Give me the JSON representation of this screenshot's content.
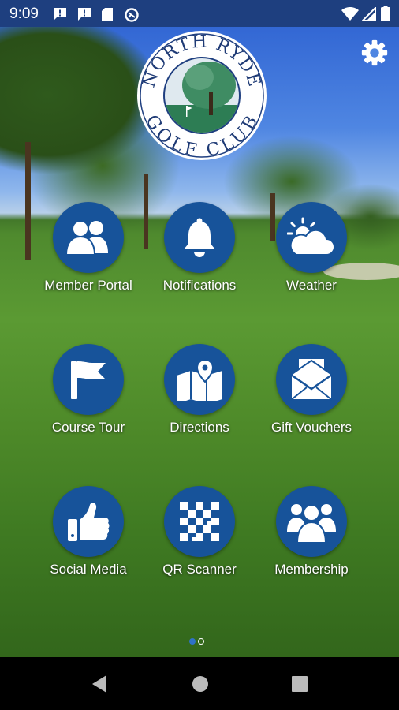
{
  "status_bar": {
    "time": "9:09",
    "icons": [
      "message-icon",
      "message-icon",
      "sd-card-icon",
      "data-saver-icon",
      "wifi-icon",
      "cellular-icon",
      "battery-icon"
    ]
  },
  "logo": {
    "text": "NORTH RYDE GOLF CLUB"
  },
  "menu": {
    "items": [
      {
        "label": "Member Portal",
        "icon": "members-icon"
      },
      {
        "label": "Notifications",
        "icon": "bell-icon"
      },
      {
        "label": "Weather",
        "icon": "weather-icon"
      },
      {
        "label": "Course Tour",
        "icon": "flag-icon"
      },
      {
        "label": "Directions",
        "icon": "map-pin-icon"
      },
      {
        "label": "Gift Vouchers",
        "icon": "envelope-icon"
      },
      {
        "label": "Social Media",
        "icon": "thumbs-up-icon"
      },
      {
        "label": "QR Scanner",
        "icon": "qr-code-icon"
      },
      {
        "label": "Membership",
        "icon": "group-icon"
      }
    ]
  },
  "pager": {
    "page_count": 2,
    "current_page": 1
  },
  "colors": {
    "accent": "#17539a",
    "status_bar": "#1e3f7f",
    "nav_bar": "#000000"
  }
}
